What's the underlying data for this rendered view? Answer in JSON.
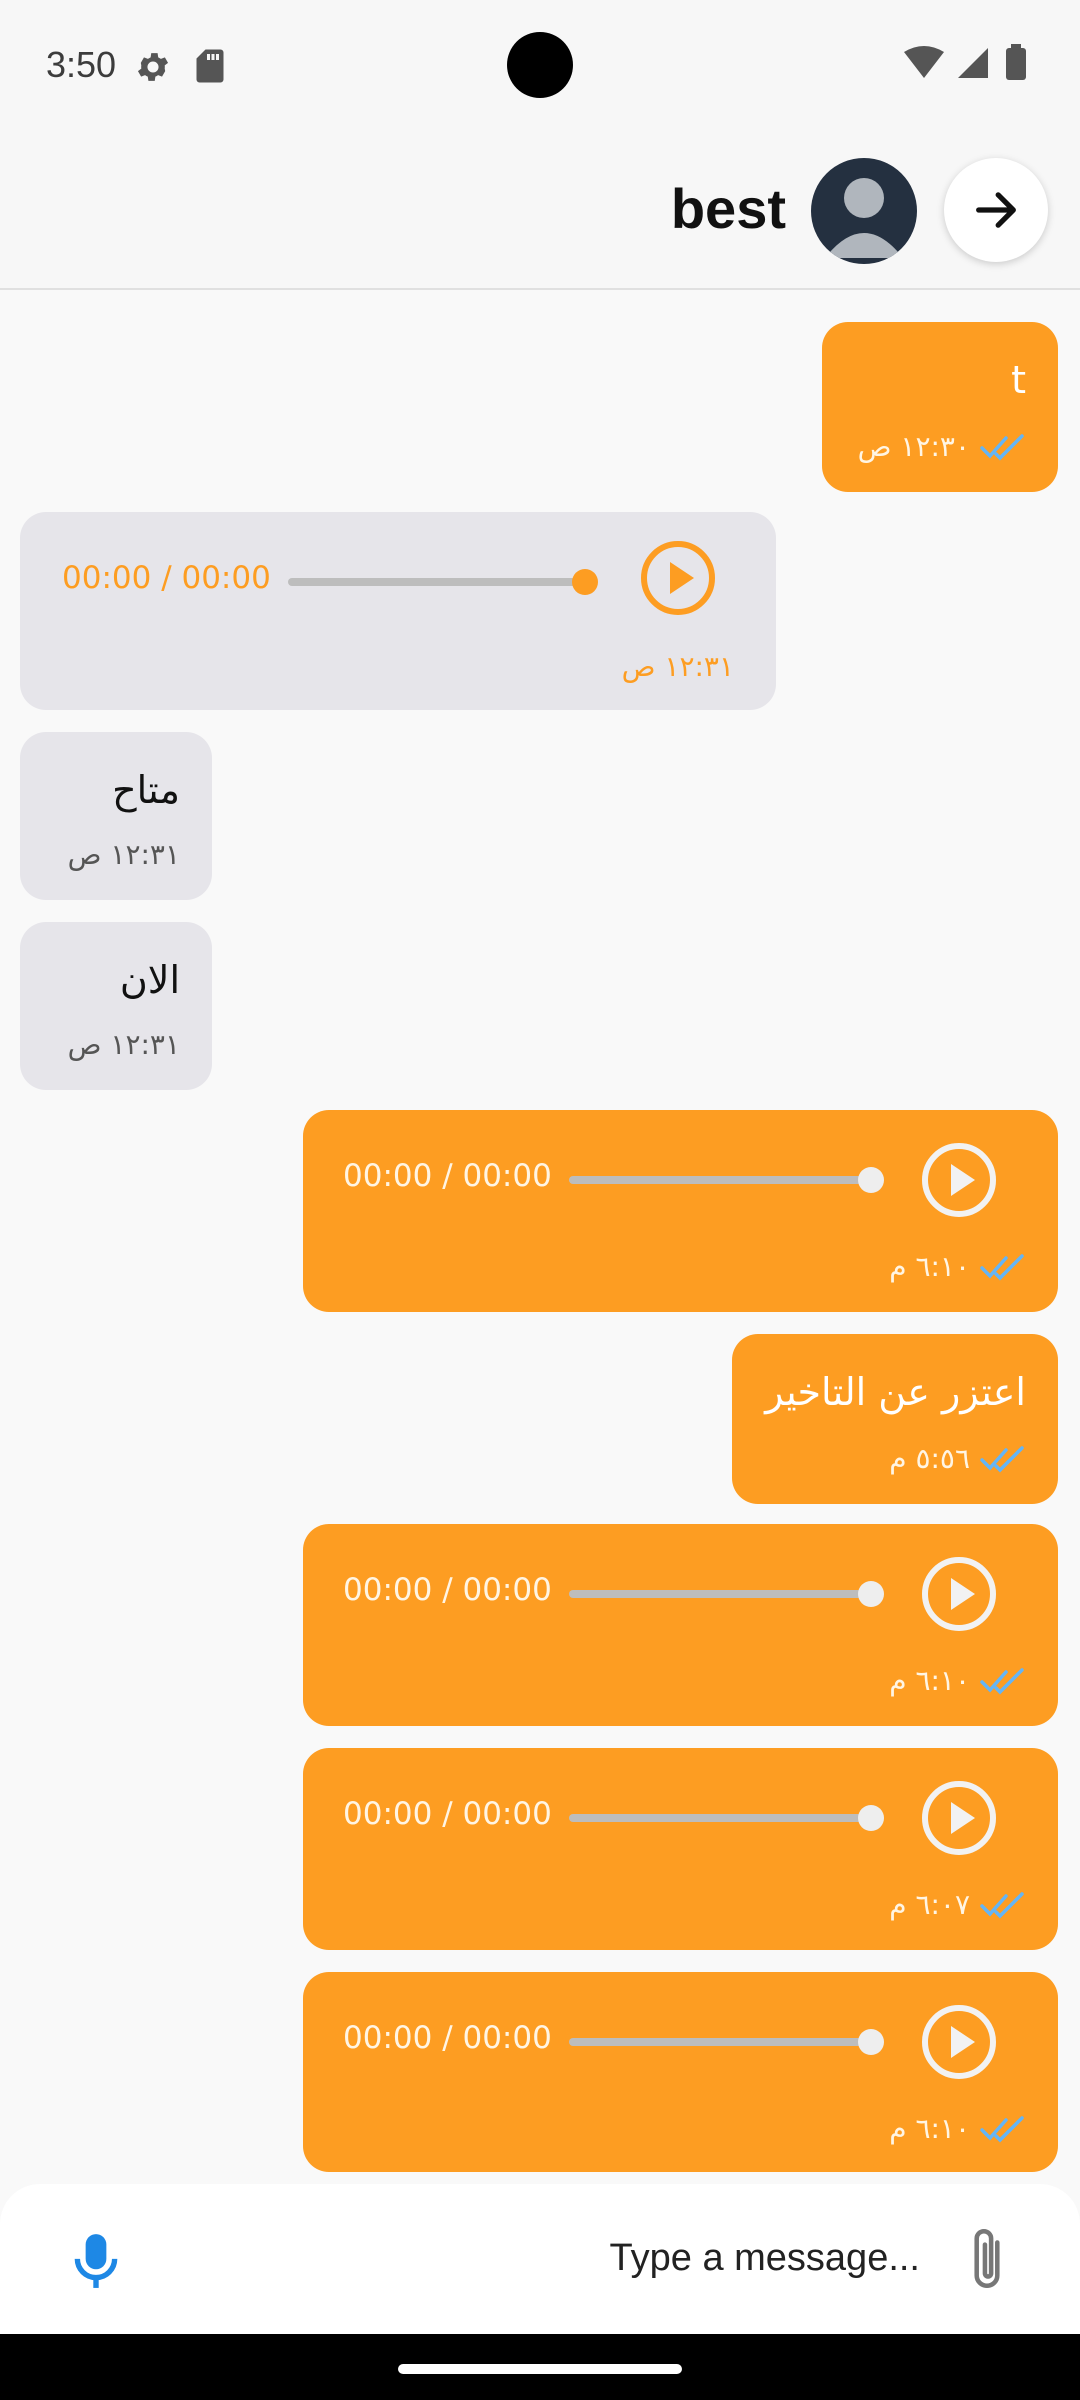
{
  "status_bar": {
    "time": "3:50"
  },
  "header": {
    "name": "best"
  },
  "messages": [
    {
      "kind": "text",
      "dir": "out",
      "text": "t",
      "time": "١٢:٣٠ ص",
      "read": true
    },
    {
      "kind": "audio",
      "dir": "in",
      "duration": "00:00 / 00:00",
      "progress": 1.0,
      "time": "١٢:٣١ ص"
    },
    {
      "kind": "text",
      "dir": "in",
      "text": "متاح",
      "time": "١٢:٣١ ص"
    },
    {
      "kind": "text",
      "dir": "in",
      "text": "الان",
      "time": "١٢:٣١ ص"
    },
    {
      "kind": "audio",
      "dir": "out",
      "duration": "00:00 / 00:00",
      "progress": 1.0,
      "time": "٦:١٠ م",
      "read": true
    },
    {
      "kind": "text",
      "dir": "out",
      "text": "اعتزر عن التاخير",
      "time": "٥:٥٦ م",
      "read": true
    },
    {
      "kind": "audio",
      "dir": "out",
      "duration": "00:00 / 00:00",
      "progress": 1.0,
      "time": "٦:١٠ م",
      "read": true
    },
    {
      "kind": "audio",
      "dir": "out",
      "duration": "00:00 / 00:00",
      "progress": 1.0,
      "time": "٦:٠٧ م",
      "read": true
    },
    {
      "kind": "audio",
      "dir": "out",
      "duration": "00:00 / 00:00",
      "progress": 1.0,
      "time": "٦:١٠ م",
      "read": true
    }
  ],
  "composer": {
    "placeholder": "Type a message..."
  },
  "colors": {
    "outgoing": "#fd9d22",
    "incoming": "#e6e5ea",
    "read_ticks": "#64b5f6",
    "mic": "#1e88e5"
  },
  "icons": [
    "settings-icon",
    "sd-card-icon",
    "wifi-icon",
    "signal-icon",
    "battery-icon",
    "arrow-right-icon",
    "avatar-icon",
    "play-icon",
    "double-check-icon",
    "mic-icon",
    "attach-icon"
  ]
}
